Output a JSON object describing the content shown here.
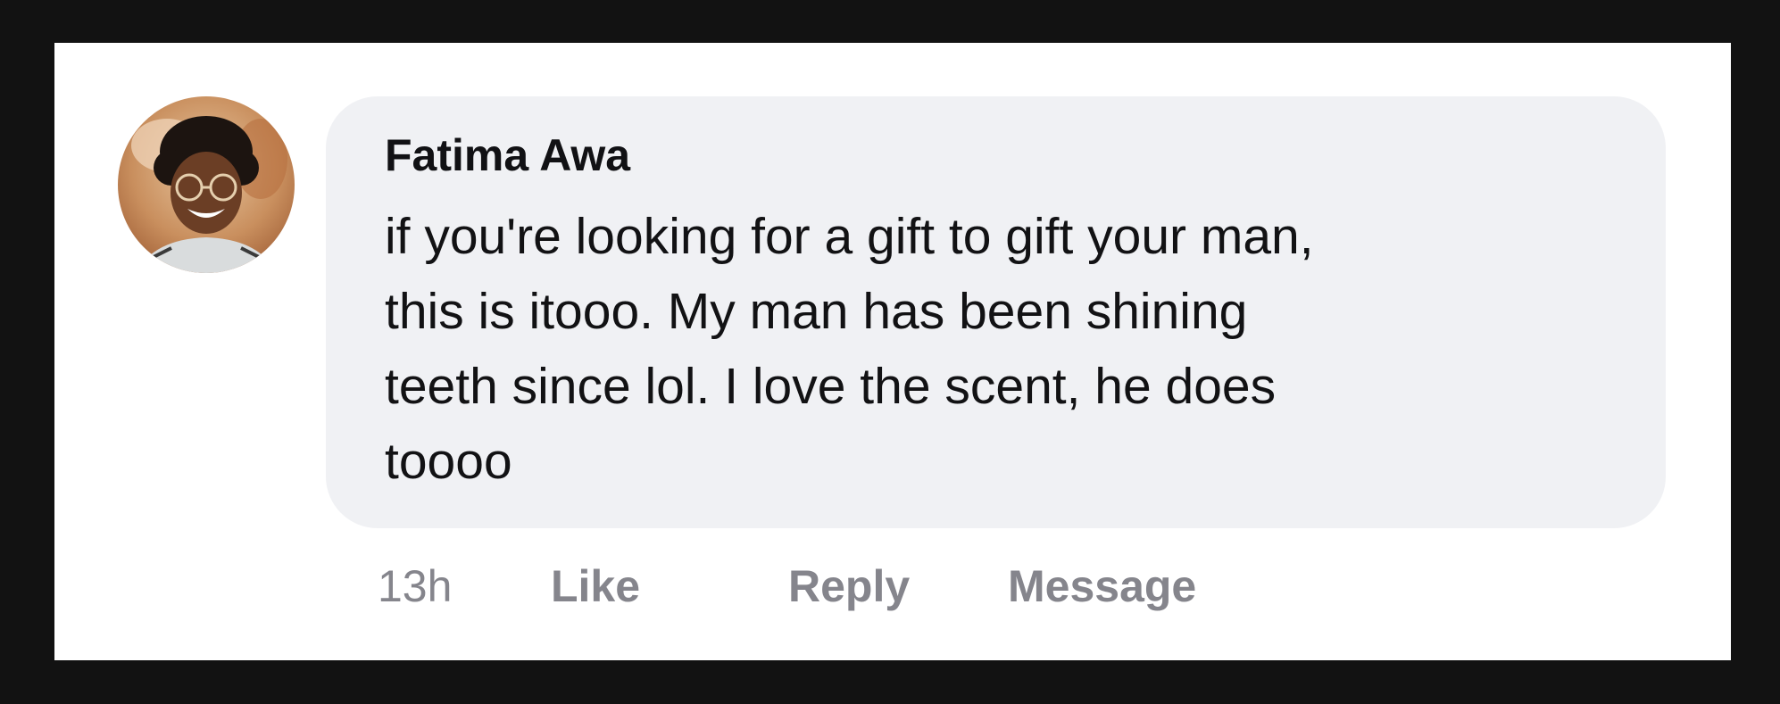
{
  "comment": {
    "author": "Fatima Awa",
    "body_lines": [
      "if you're looking for a gift to gift your man,",
      "this is itooo. My man has been shining",
      "teeth since lol. I love the scent, he does",
      "toooo"
    ],
    "actions": {
      "timestamp": "13h",
      "like": "Like",
      "reply": "Reply",
      "message": "Message"
    }
  },
  "colors": {
    "page_background": "#121212",
    "card_background": "#ffffff",
    "bubble_background": "#f0f1f4",
    "author_text": "#111114",
    "body_text": "#121214",
    "action_text": "#85858c"
  },
  "icons": {
    "avatar": "profile-photo"
  }
}
